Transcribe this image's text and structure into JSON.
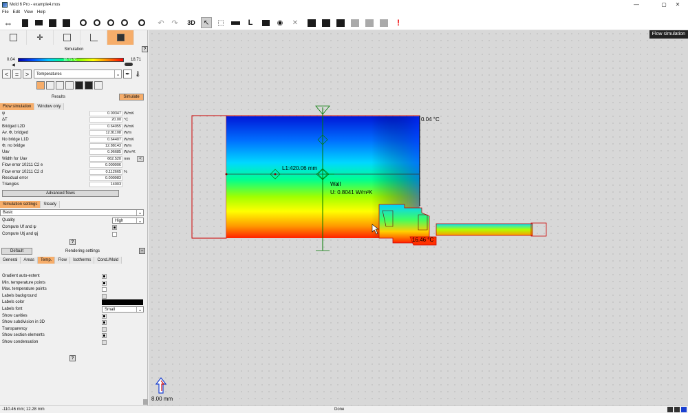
{
  "window": {
    "title": "Mold 6 Pro - example4.mos"
  },
  "menu": [
    "File",
    "Edit",
    "View",
    "Help"
  ],
  "toolbar": {
    "threed_label": "3D"
  },
  "panel": {
    "simulation_header": "Simulation",
    "help": "?",
    "gradient": {
      "min": "0.04",
      "mid": "18.71 °C",
      "max": "18.71"
    },
    "nav": {
      "prev": "<",
      "eq": "=",
      "next": ">"
    },
    "display_select": "Temperatures",
    "results_label": "Results",
    "simulate_label": "Simulate",
    "result_tabs": [
      "Flow simulation",
      "Window only"
    ],
    "results": [
      {
        "label": "ψ",
        "value": "0.00347",
        "unit": "W/mK"
      },
      {
        "label": "ΔT",
        "value": "20.00",
        "unit": "°C"
      },
      {
        "label": "Bridged L2D",
        "value": "0.64055",
        "unit": "W/mK"
      },
      {
        "label": "Av. Φ, bridged",
        "value": "12.81108",
        "unit": "W/m"
      },
      {
        "label": "No bridge L1D",
        "value": "0.64407",
        "unit": "W/mK"
      },
      {
        "label": "Φ, no bridge",
        "value": "12.88143",
        "unit": "W/m"
      },
      {
        "label": "Uav",
        "value": "0.96685",
        "unit": "W/m²K"
      },
      {
        "label": "Width for Uav",
        "value": "662.520",
        "unit": "mm"
      },
      {
        "label": "Flow error 10211 C2 e",
        "value": "0.000006",
        "unit": ""
      },
      {
        "label": "Flow error 10211 C2 d",
        "value": "0.112665",
        "unit": "%"
      },
      {
        "label": "Residual error",
        "value": "0.000983",
        "unit": ""
      },
      {
        "label": "Triangles",
        "value": "14003",
        "unit": ""
      }
    ],
    "advanced_flows": "Advanced flows",
    "sim_tabs": [
      "Simulation settings",
      "Steady"
    ],
    "sim_mode": "Basic",
    "quality_label": "Quality",
    "quality_value": "High",
    "compute_uf": "Compute Uf and ψ",
    "compute_ug": "Compute Utj and ψj",
    "default_label": "Default",
    "rendering_settings": "Rendering settings",
    "render_tabs": [
      "General",
      "Areas",
      "Temp.",
      "Flow",
      "Isotherms",
      "Cond./Mold"
    ],
    "render_options": [
      {
        "label": "Gradient auto-extent",
        "state": "on"
      },
      {
        "label": "Min. temperature points",
        "state": "on"
      },
      {
        "label": "Max. temperature points",
        "state": "off"
      },
      {
        "label": "Labels background",
        "state": "dis"
      },
      {
        "label": "Labels color",
        "state": "color"
      },
      {
        "label": "Labels font",
        "state": "select"
      },
      {
        "label": "Show cavities",
        "state": "on"
      },
      {
        "label": "Show subdivision in 3D",
        "state": "on"
      },
      {
        "label": "Transparency",
        "state": "dis"
      },
      {
        "label": "Show section elements",
        "state": "on"
      },
      {
        "label": "Show condensation",
        "state": "dis"
      }
    ],
    "labels_font_value": "Small"
  },
  "canvas": {
    "badge": "Flow simulation",
    "max_temp_label": "0.04 °C",
    "length_label": "L1:420.06 mm",
    "wall_name": "Wall",
    "wall_u": "U: 0.8041 W/m²K",
    "min_temp_label": "16.46 °C",
    "scale_label": "8.00 mm"
  },
  "status": {
    "coords": "-110.46 mm; 12.28 mm",
    "state": "Done"
  }
}
